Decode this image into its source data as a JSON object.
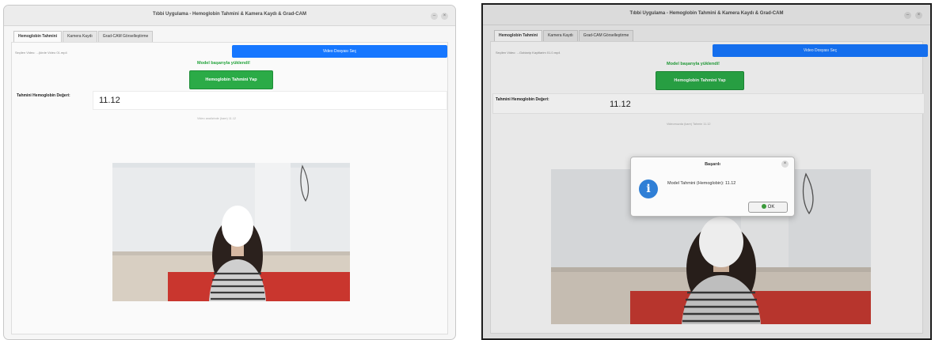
{
  "window": {
    "title": "Tıbbi Uygulama - Hemoglobin Tahmini & Kamera Kaydı & Grad-CAM"
  },
  "tabs": [
    {
      "label": "Hemoglobin Tahmini",
      "active": true
    },
    {
      "label": "Kamera Kaydı",
      "active": false
    },
    {
      "label": "Grad-CAM Görselleştirme",
      "active": false
    }
  ],
  "left": {
    "path_text": "Seçilen Video: ...(kirde Video 01.mp4",
    "select_button": "Video Dosyası Seç",
    "model_status": "Model başarıyla yüklendi!",
    "predict_button": "Hemoglobin Tahmini Yap",
    "result_label": "Tahmini Hemoglobin Değeri:",
    "result_value": "11.12",
    "hint": "Video analizinde (kare) 11.12"
  },
  "right": {
    "path_text": "Seçilen Video: ...Gobiarip Kayitlarim 01.0.mp4",
    "select_button": "Video Dosyası Seç",
    "model_status": "Model başarıyla yüklendi!",
    "predict_button": "Hemoglobin Tahmini Yap",
    "result_label": "Tahmini Hemoglobin Değeri:",
    "result_value": "11.12",
    "hint": "Videomuzda (kare) Tahmin 11.12"
  },
  "dialog": {
    "title": "Başarılı",
    "message": "Model Tahmini (Hemoglobin): 11.12",
    "ok_label": "OK",
    "icon": "info-icon"
  },
  "colors": {
    "accent_blue": "#1677ff",
    "accent_green": "#2bab47",
    "status_green": "#22a33a"
  }
}
